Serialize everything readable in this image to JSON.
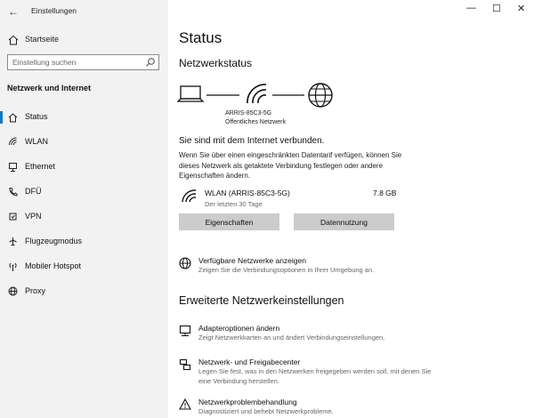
{
  "window": {
    "title": "Einstellungen",
    "minimize": "—",
    "maximize": "☐",
    "close": "✕"
  },
  "sidebar": {
    "back_glyph": "←",
    "home_label": "Startseite",
    "search_placeholder": "Einstellung suchen",
    "section_title": "Netzwerk und Internet",
    "items": [
      {
        "label": "Status",
        "icon": "home-icon"
      },
      {
        "label": "WLAN",
        "icon": "wifi-icon"
      },
      {
        "label": "Ethernet",
        "icon": "ethernet-icon"
      },
      {
        "label": "DFÜ",
        "icon": "phone-icon"
      },
      {
        "label": "VPN",
        "icon": "vpn-icon"
      },
      {
        "label": "Flugzeugmodus",
        "icon": "airplane-icon"
      },
      {
        "label": "Mobiler Hotspot",
        "icon": "hotspot-icon"
      },
      {
        "label": "Proxy",
        "icon": "globe-icon"
      }
    ]
  },
  "main": {
    "title": "Status",
    "network_status_heading": "Netzwerkstatus",
    "network_name": "ARRIS-85C3-5G",
    "network_kind": "Öffentliches Netzwerk",
    "connected_text": "Sie sind mit dem Internet verbunden.",
    "description": "Wenn Sie über einen eingeschränkten Datentarif verfügen, können Sie dieses Netzwerk als getaktete Verbindung festlegen oder andere Eigenschaften ändern.",
    "wlan": {
      "name": "WLAN (ARRIS-85C3-5G)",
      "period": "Der letzten 30 Tage",
      "usage": "7.8 GB"
    },
    "buttons": {
      "properties": "Eigenschaften",
      "data_usage": "Datennutzung"
    },
    "available_networks": {
      "title": "Verfügbare Netzwerke anzeigen",
      "desc": "Zeigen Sie die Verbindungsoptionen in Ihrer Umgebung an."
    },
    "advanced_heading": "Erweiterte Netzwerkeinstellungen",
    "links": [
      {
        "title": "Adapteroptionen ändern",
        "desc": "Zeigt Netzwerkkarten an und ändert Verbindungseinstellungen.",
        "icon": "adapter-icon"
      },
      {
        "title": "Netzwerk- und Freigabecenter",
        "desc": "Legen Sie fest, was in den Netzwerken freigegeben werden soll, mit denen Sie eine Verbindung herstellen.",
        "icon": "sharing-center-icon"
      },
      {
        "title": "Netzwerkproblembehandlung",
        "desc": "Diagnostiziert und behebt Netzwerkprobleme.",
        "icon": "warning-icon"
      }
    ]
  }
}
